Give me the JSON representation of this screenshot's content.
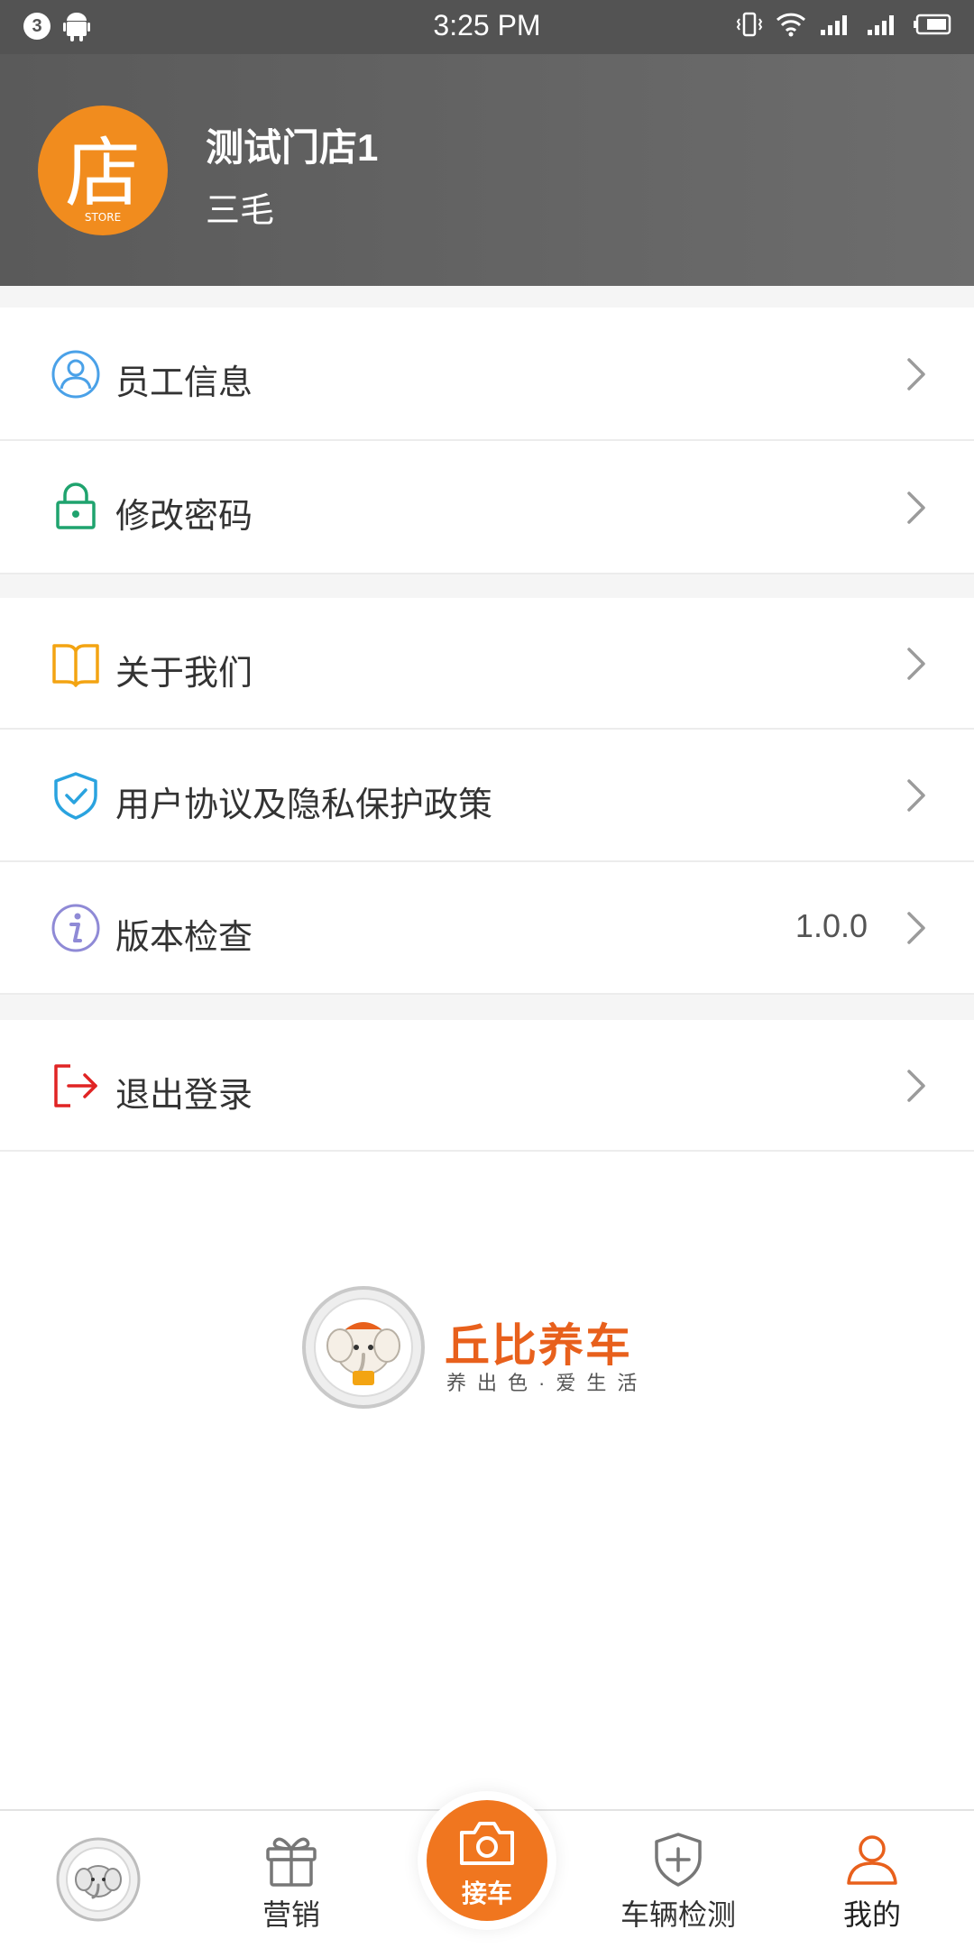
{
  "status_bar": {
    "badge": "3",
    "time": "3:25 PM"
  },
  "profile": {
    "avatar_icon": "store-icon",
    "avatar_char": "店",
    "avatar_caption": "STORE",
    "store_name": "测试门店1",
    "user_name": "三毛"
  },
  "menu": {
    "staff_info": "员工信息",
    "change_password": "修改密码",
    "about_us": "关于我们",
    "agreement": "用户协议及隐私保护政策",
    "version_check": "版本检查",
    "version_value": "1.0.0",
    "logout": "退出登录"
  },
  "brand": {
    "title": "丘比养车",
    "slogan": "养出色·爱生活"
  },
  "tabbar": {
    "marketing": "营销",
    "pickup": "接车",
    "inspection": "车辆检测",
    "mine": "我的"
  },
  "colors": {
    "accent": "#f0761f",
    "header_bg": "#5f5f5f",
    "brand": "#e8601c"
  }
}
